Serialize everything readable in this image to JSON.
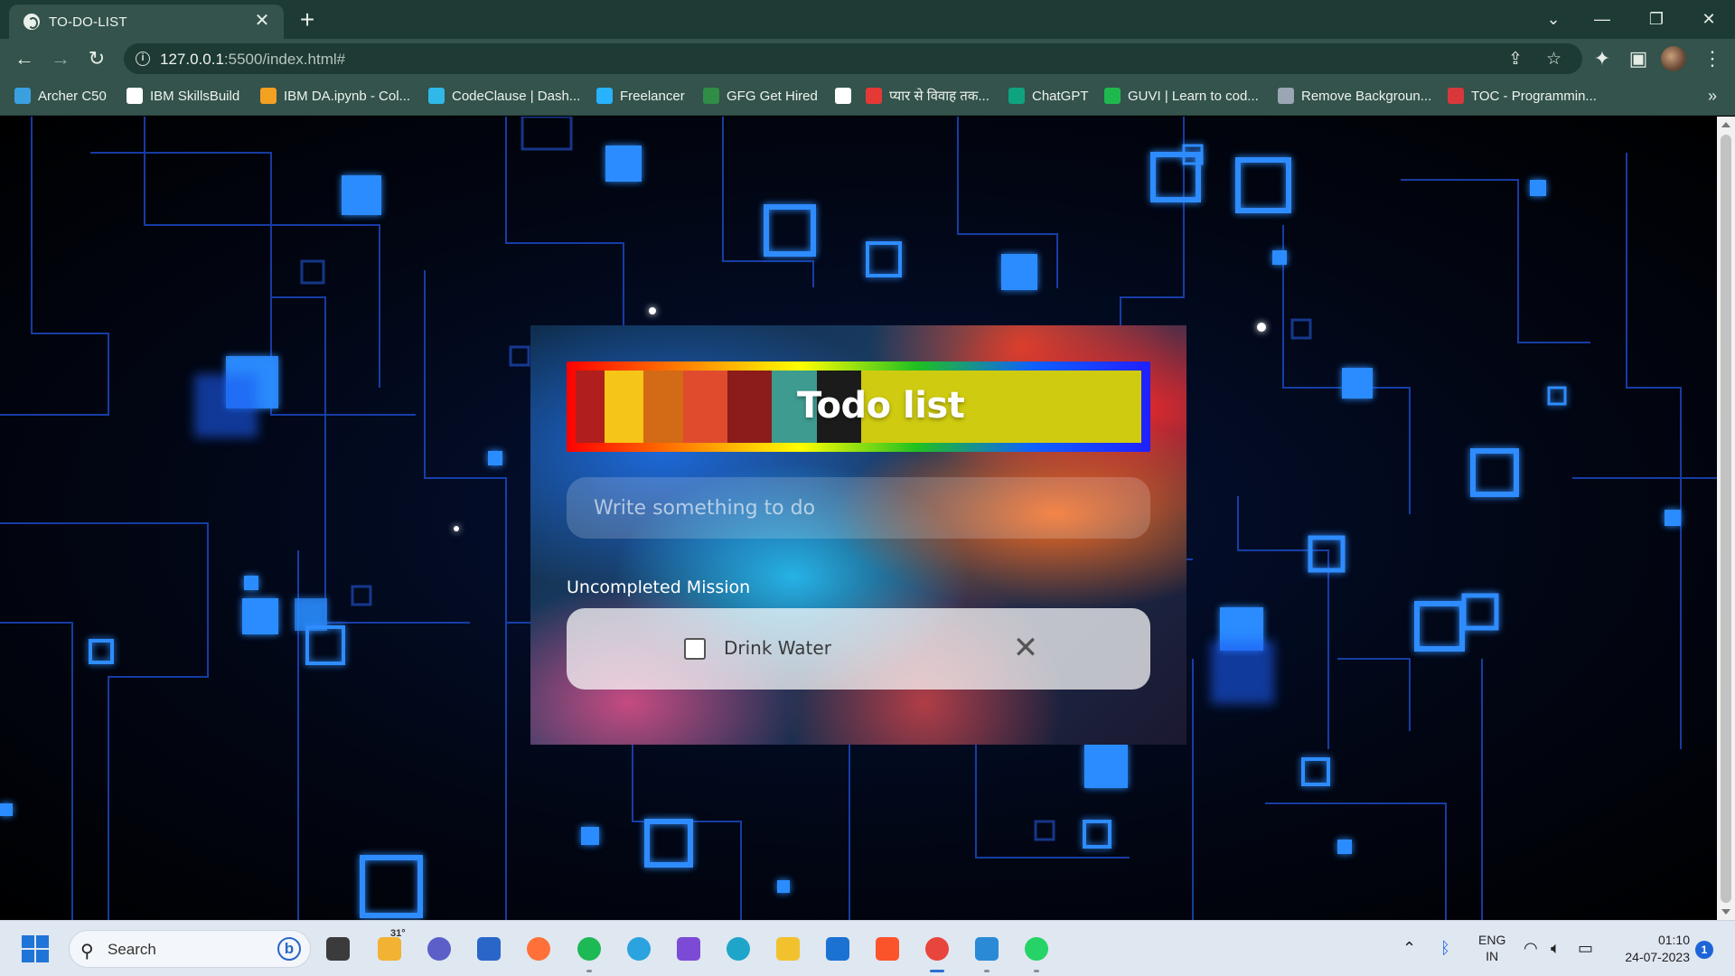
{
  "browser": {
    "tab_title": "TO-DO-LIST",
    "tab_close": "✕",
    "new_tab": "+",
    "url_host": "127.0.0.1",
    "url_rest": ":5500/index.html#",
    "window_controls": {
      "dropdown": "⌄",
      "minimize": "—",
      "restore": "❐",
      "close": "✕"
    },
    "nav": {
      "back": "←",
      "forward": "→",
      "reload": "↻"
    },
    "bookmarks": [
      {
        "label": "Archer C50",
        "color": "#3aa0e0"
      },
      {
        "label": "IBM SkillsBuild",
        "color": "#ffffff"
      },
      {
        "label": "IBM DA.ipynb - Col...",
        "color": "#f4a020"
      },
      {
        "label": "CodeClause | Dash...",
        "color": "#2fb8e8"
      },
      {
        "label": "Freelancer",
        "color": "#29b2fe"
      },
      {
        "label": "GFG Get Hired",
        "color": "#2f8d46"
      },
      {
        "label": "",
        "color": "#ffffff"
      },
      {
        "label": "प्यार से विवाह तक...",
        "color": "#e53935"
      },
      {
        "label": "ChatGPT",
        "color": "#10a37f"
      },
      {
        "label": "GUVI | Learn to cod...",
        "color": "#1fb84f"
      },
      {
        "label": "Remove Backgroun...",
        "color": "#9aa6b3"
      },
      {
        "label": "TOC - Programmin...",
        "color": "#d9383a"
      }
    ],
    "bookmarks_more": "»"
  },
  "app": {
    "title": "Todo list",
    "input_placeholder": "Write something to do",
    "input_value": "",
    "section_label": "Uncompleted Mission",
    "tasks": [
      {
        "text": "Drink Water",
        "checked": false,
        "delete": "✕"
      }
    ],
    "title_colors": [
      "#b01e1e",
      "#f5c518",
      "#d36a15",
      "#e14b2d",
      "#8c1b1b",
      "#3d9c8f",
      "#1b1b1b"
    ]
  },
  "taskbar": {
    "search_label": "Search",
    "weather_temp": "31°",
    "language": "ENG",
    "region": "IN",
    "time": "01:10",
    "date": "24-07-2023",
    "notification_count": "1",
    "apps": [
      {
        "name": "file-explorer-task-view",
        "color": "#3b3b3b"
      },
      {
        "name": "weather-widget",
        "color": "#f2b233"
      },
      {
        "name": "teams",
        "color": "#5b5fc7"
      },
      {
        "name": "microsoft-store",
        "color": "#2a65c8"
      },
      {
        "name": "firefox",
        "color": "#ff7139"
      },
      {
        "name": "spotify",
        "color": "#1db954"
      },
      {
        "name": "telegram",
        "color": "#2aa3de"
      },
      {
        "name": "clipchamp",
        "color": "#7b4bd6"
      },
      {
        "name": "edge",
        "color": "#1ea5c9"
      },
      {
        "name": "file-explorer",
        "color": "#f2c12e"
      },
      {
        "name": "mail",
        "color": "#1b72d2"
      },
      {
        "name": "brave",
        "color": "#fb542b"
      },
      {
        "name": "chrome",
        "color": "#e8453c"
      },
      {
        "name": "vscode",
        "color": "#2a8ad6"
      },
      {
        "name": "whatsapp",
        "color": "#25d366"
      }
    ]
  }
}
